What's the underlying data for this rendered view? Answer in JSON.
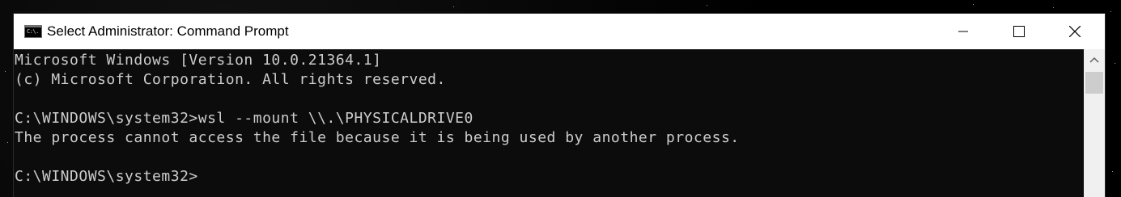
{
  "window": {
    "title": "Select Administrator: Command Prompt",
    "icon": "command-prompt-icon",
    "icon_label": "C:\\."
  },
  "controls": {
    "minimize_icon": "minimize-icon",
    "maximize_icon": "maximize-icon",
    "close_icon": "close-icon"
  },
  "console": {
    "lines": [
      "Microsoft Windows [Version 10.0.21364.1]",
      "(c) Microsoft Corporation. All rights reserved.",
      "",
      "C:\\WINDOWS\\system32>wsl --mount \\\\.\\PHYSICALDRIVE0",
      "The process cannot access the file because it is being used by another process.",
      "",
      "C:\\WINDOWS\\system32>"
    ]
  },
  "colors": {
    "console_bg": "#0c0c0c",
    "console_text": "#cccccc",
    "titlebar_bg": "#ffffff"
  }
}
